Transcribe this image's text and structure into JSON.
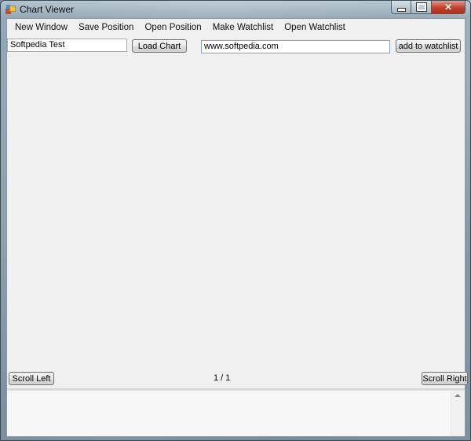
{
  "window": {
    "title": "Chart Viewer",
    "controls": {
      "minimize": "minimize",
      "maximize": "maximize",
      "close": "close"
    }
  },
  "menu": {
    "items": [
      {
        "label": "New Window"
      },
      {
        "label": "Save Position"
      },
      {
        "label": "Open Position"
      },
      {
        "label": "Make Watchlist"
      },
      {
        "label": "Open Watchlist"
      }
    ]
  },
  "toolbar": {
    "chart_name_value": "Softpedia Test",
    "load_chart_label": "Load Chart",
    "url_value": "www.softpedia.com",
    "add_to_watchlist_label": "add to watchlist"
  },
  "navigation": {
    "scroll_left_label": "Scroll Left",
    "page_indicator": "1 / 1",
    "scroll_right_label": "Scroll Right"
  },
  "output": {
    "text": ""
  },
  "icons": {
    "app": "app-icon",
    "scroll_up": "scroll-up-arrow-icon"
  }
}
